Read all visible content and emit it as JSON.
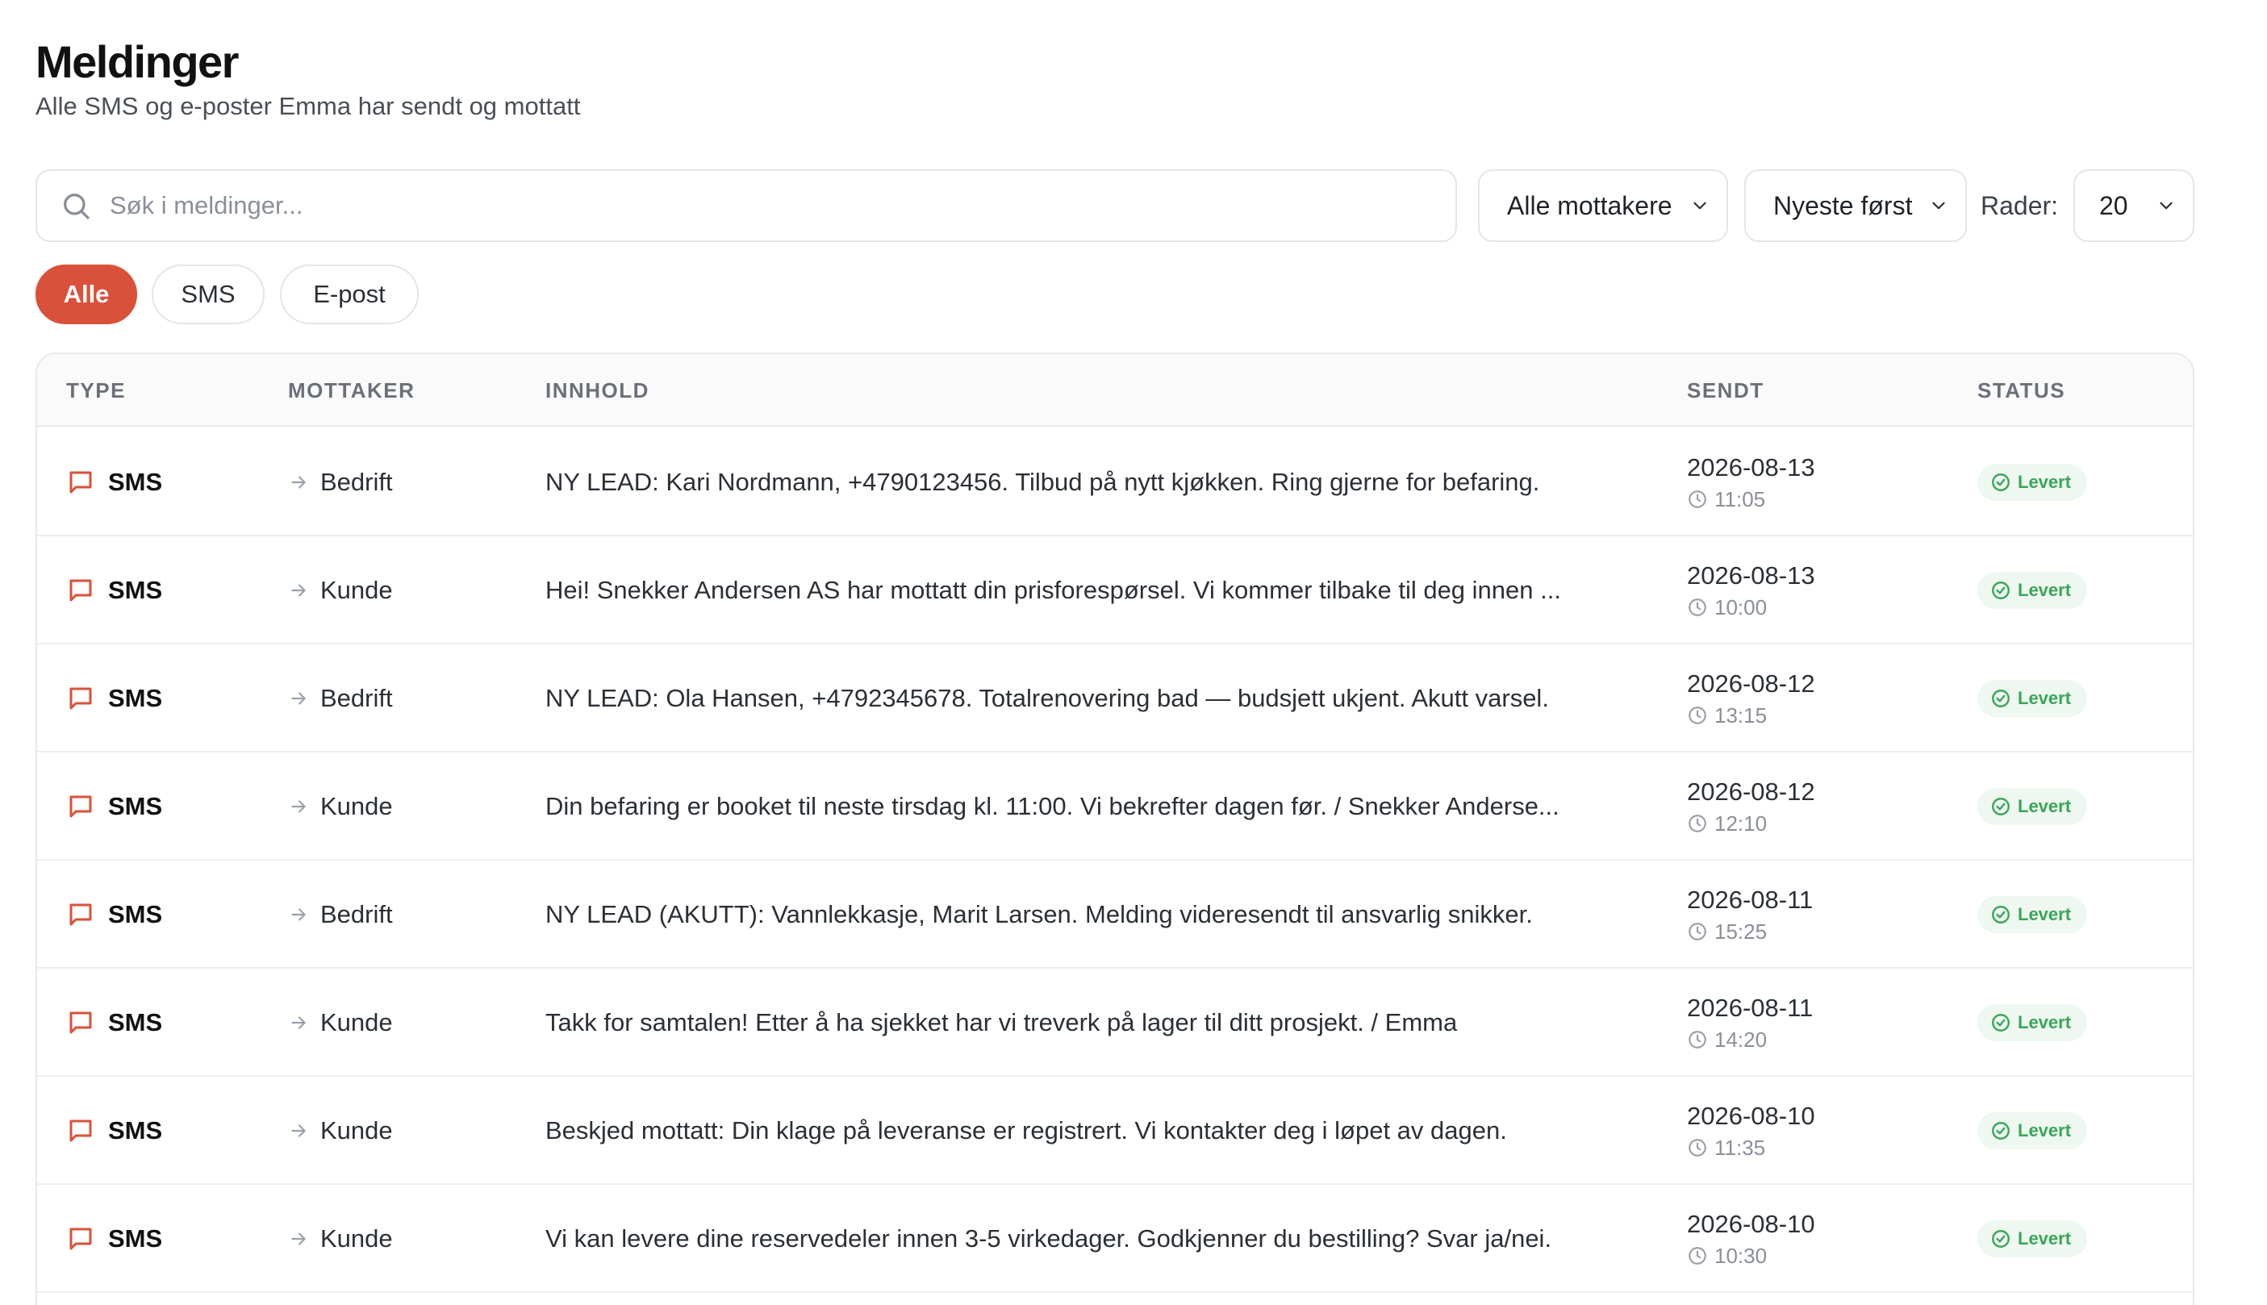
{
  "header": {
    "title": "Meldinger",
    "subtitle": "Alle SMS og e-poster Emma har sendt og mottatt"
  },
  "toolbar": {
    "search_placeholder": "Søk i meldinger...",
    "recipient_filter": "Alle mottakere",
    "sort": "Nyeste først",
    "rows_label": "Rader:",
    "rows_value": "20"
  },
  "filters": {
    "all": "Alle",
    "sms": "SMS",
    "email": "E-post",
    "active": "Alle"
  },
  "colors": {
    "accent": "#d9513a",
    "status_green": "#3aa55a"
  },
  "table": {
    "headers": {
      "type": "TYPE",
      "recipient": "MOTTAKER",
      "content": "INNHOLD",
      "sent": "SENDT",
      "status": "STATUS"
    },
    "rows": [
      {
        "type": "SMS",
        "icon": "message-icon",
        "recipient": "Bedrift",
        "content": "NY LEAD: Kari Nordmann, +4790123456. Tilbud på nytt kjøkken. Ring gjerne for befaring.",
        "date": "2026-08-13",
        "time": "11:05",
        "status": "Levert"
      },
      {
        "type": "SMS",
        "icon": "message-icon",
        "recipient": "Kunde",
        "content": "Hei! Snekker Andersen AS har mottatt din prisforespørsel. Vi kommer tilbake til deg innen ...",
        "date": "2026-08-13",
        "time": "10:00",
        "status": "Levert"
      },
      {
        "type": "SMS",
        "icon": "message-icon",
        "recipient": "Bedrift",
        "content": "NY LEAD: Ola Hansen, +4792345678. Totalrenovering bad — budsjett ukjent. Akutt varsel.",
        "date": "2026-08-12",
        "time": "13:15",
        "status": "Levert"
      },
      {
        "type": "SMS",
        "icon": "message-icon",
        "recipient": "Kunde",
        "content": "Din befaring er booket til neste tirsdag kl. 11:00. Vi bekrefter dagen før. / Snekker Anderse...",
        "date": "2026-08-12",
        "time": "12:10",
        "status": "Levert"
      },
      {
        "type": "SMS",
        "icon": "message-icon",
        "recipient": "Bedrift",
        "content": "NY LEAD (AKUTT): Vannlekkasje, Marit Larsen. Melding videresendt til ansvarlig snikker.",
        "date": "2026-08-11",
        "time": "15:25",
        "status": "Levert"
      },
      {
        "type": "SMS",
        "icon": "message-icon",
        "recipient": "Kunde",
        "content": "Takk for samtalen! Etter å ha sjekket har vi treverk på lager til ditt prosjekt. / Emma",
        "date": "2026-08-11",
        "time": "14:20",
        "status": "Levert"
      },
      {
        "type": "SMS",
        "icon": "message-icon",
        "recipient": "Kunde",
        "content": "Beskjed mottatt: Din klage på leveranse er registrert. Vi kontakter deg i løpet av dagen.",
        "date": "2026-08-10",
        "time": "11:35",
        "status": "Levert"
      },
      {
        "type": "SMS",
        "icon": "message-icon",
        "recipient": "Kunde",
        "content": "Vi kan levere dine reservedeler innen 3-5 virkedager. Godkjenner du bestilling? Svar ja/nei.",
        "date": "2026-08-10",
        "time": "10:30",
        "status": "Levert"
      }
    ]
  }
}
